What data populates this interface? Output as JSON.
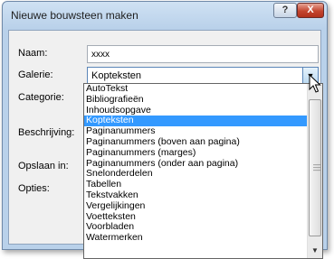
{
  "window": {
    "title": "Nieuwe bouwsteen maken",
    "help_label": "?",
    "close_label": "X"
  },
  "form": {
    "naam_label": "Naam:",
    "naam_value": "xxxx",
    "galerie_label": "Galerie:",
    "galerie_value": "Kopteksten",
    "categorie_label": "Categorie:",
    "beschrijving_label": "Beschrijving:",
    "opslaan_label": "Opslaan in:",
    "opties_label": "Opties:"
  },
  "dropdown": {
    "selected_index": 3,
    "items": [
      "AutoTekst",
      "Bibliografieën",
      "Inhoudsopgave",
      "Kopteksten",
      "Paginanummers",
      "Paginanummers (boven aan pagina)",
      "Paginanummers (marges)",
      "Paginanummers (onder aan pagina)",
      "Snelonderdelen",
      "Tabellen",
      "Tekstvakken",
      "Vergelijkingen",
      "Voetteksten",
      "Voorbladen",
      "Watermerken"
    ]
  }
}
